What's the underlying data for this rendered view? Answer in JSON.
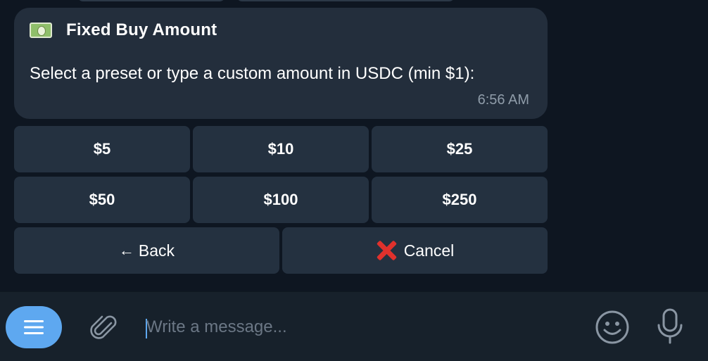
{
  "message": {
    "icon": "money-bill-icon",
    "title": "Fixed Buy Amount",
    "text": "Select a preset or type a custom amount in USDC (min $1):",
    "time": "6:56 AM"
  },
  "keyboard": {
    "row1": [
      "$5",
      "$10",
      "$25"
    ],
    "row2": [
      "$50",
      "$100",
      "$250"
    ],
    "back": {
      "icon": "left-arrow-icon",
      "arrow": "←",
      "label": "Back"
    },
    "cancel": {
      "icon": "red-cross-icon",
      "label": "Cancel"
    }
  },
  "composer": {
    "placeholder": "Write a message...",
    "menu_icon": "menu-icon",
    "attach_icon": "paperclip-icon",
    "emoji_icon": "smiley-icon",
    "mic_icon": "microphone-icon"
  },
  "colors": {
    "background": "#0e1621",
    "bubble": "#232e3c",
    "button": "#243140",
    "accent": "#5ea8f0",
    "cancel_red": "#e0312c"
  }
}
